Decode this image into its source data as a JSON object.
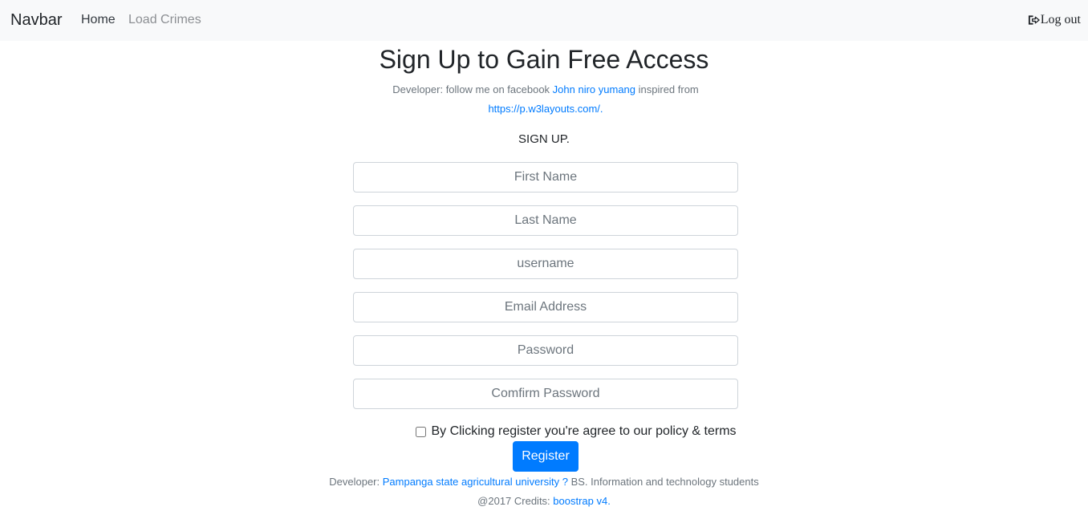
{
  "navbar": {
    "brand": "Navbar",
    "home": "Home",
    "load_crimes": "Load Crimes",
    "logout": "Log out"
  },
  "header": {
    "title": "Sign Up to Gain Free Access",
    "dev_prefix": "Developer: follow me on facebook ",
    "dev_name": "John niro yumang",
    "dev_middle": " inspired from",
    "dev_link": "https://p.w3layouts.com/."
  },
  "form": {
    "heading": "SIGN UP.",
    "first_name_placeholder": "First Name",
    "last_name_placeholder": "Last Name",
    "username_placeholder": "username",
    "email_placeholder": "Email Address",
    "password_placeholder": "Password",
    "confirm_password_placeholder": "Comfirm Password",
    "agree_text": "By Clicking register you're agree to our policy & terms",
    "register_label": "Register"
  },
  "footer": {
    "dev_prefix": "Developer: ",
    "dev_link": "Pampanga state agricultural university ?",
    "dev_suffix": " BS. Information and technology students",
    "credits_prefix": "@2017 Credits: ",
    "credits_link": "boostrap v4."
  },
  "colors": {
    "primary": "#007bff",
    "navbar_bg": "#f8f9fa"
  }
}
